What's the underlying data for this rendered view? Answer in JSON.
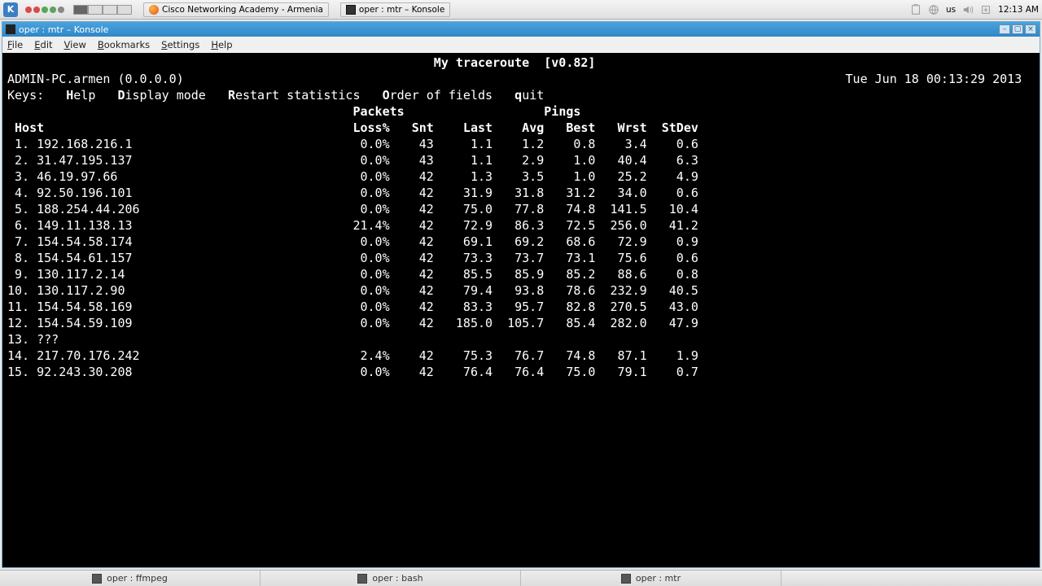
{
  "panel": {
    "task1": "Cisco Networking Academy - Armenia",
    "task2": "oper : mtr – Konsole",
    "lang": "us",
    "clock": "12:13 AM"
  },
  "window": {
    "title": "oper : mtr – Konsole",
    "menu": {
      "file": "File",
      "edit": "Edit",
      "view": "View",
      "bookmarks": "Bookmarks",
      "settings": "Settings",
      "help": "Help"
    }
  },
  "mtr": {
    "title": "My traceroute  [v0.82]",
    "hostline_left": "ADMIN-PC.armen (0.0.0.0)",
    "hostline_right": "Tue Jun 18 00:13:29 2013",
    "keys_prefix": "Keys:",
    "keys": [
      "Help",
      "Display mode",
      "Restart statistics",
      "Order of fields",
      "quit"
    ],
    "group_packets": "Packets",
    "group_pings": "Pings",
    "cols": {
      "host": "Host",
      "loss": "Loss%",
      "snt": "Snt",
      "last": "Last",
      "avg": "Avg",
      "best": "Best",
      "wrst": "Wrst",
      "stdev": "StDev"
    },
    "rows": [
      {
        "n": "1.",
        "host": "192.168.216.1",
        "loss": "0.0%",
        "snt": "43",
        "last": "1.1",
        "avg": "1.2",
        "best": "0.8",
        "wrst": "3.4",
        "stdev": "0.6"
      },
      {
        "n": "2.",
        "host": "31.47.195.137",
        "loss": "0.0%",
        "snt": "43",
        "last": "1.1",
        "avg": "2.9",
        "best": "1.0",
        "wrst": "40.4",
        "stdev": "6.3"
      },
      {
        "n": "3.",
        "host": "46.19.97.66",
        "loss": "0.0%",
        "snt": "42",
        "last": "1.3",
        "avg": "3.5",
        "best": "1.0",
        "wrst": "25.2",
        "stdev": "4.9"
      },
      {
        "n": "4.",
        "host": "92.50.196.101",
        "loss": "0.0%",
        "snt": "42",
        "last": "31.9",
        "avg": "31.8",
        "best": "31.2",
        "wrst": "34.0",
        "stdev": "0.6"
      },
      {
        "n": "5.",
        "host": "188.254.44.206",
        "loss": "0.0%",
        "snt": "42",
        "last": "75.0",
        "avg": "77.8",
        "best": "74.8",
        "wrst": "141.5",
        "stdev": "10.4"
      },
      {
        "n": "6.",
        "host": "149.11.138.13",
        "loss": "21.4%",
        "snt": "42",
        "last": "72.9",
        "avg": "86.3",
        "best": "72.5",
        "wrst": "256.0",
        "stdev": "41.2"
      },
      {
        "n": "7.",
        "host": "154.54.58.174",
        "loss": "0.0%",
        "snt": "42",
        "last": "69.1",
        "avg": "69.2",
        "best": "68.6",
        "wrst": "72.9",
        "stdev": "0.9"
      },
      {
        "n": "8.",
        "host": "154.54.61.157",
        "loss": "0.0%",
        "snt": "42",
        "last": "73.3",
        "avg": "73.7",
        "best": "73.1",
        "wrst": "75.6",
        "stdev": "0.6"
      },
      {
        "n": "9.",
        "host": "130.117.2.14",
        "loss": "0.0%",
        "snt": "42",
        "last": "85.5",
        "avg": "85.9",
        "best": "85.2",
        "wrst": "88.6",
        "stdev": "0.8"
      },
      {
        "n": "10.",
        "host": "130.117.2.90",
        "loss": "0.0%",
        "snt": "42",
        "last": "79.4",
        "avg": "93.8",
        "best": "78.6",
        "wrst": "232.9",
        "stdev": "40.5"
      },
      {
        "n": "11.",
        "host": "154.54.58.169",
        "loss": "0.0%",
        "snt": "42",
        "last": "83.3",
        "avg": "95.7",
        "best": "82.8",
        "wrst": "270.5",
        "stdev": "43.0"
      },
      {
        "n": "12.",
        "host": "154.54.59.109",
        "loss": "0.0%",
        "snt": "42",
        "last": "185.0",
        "avg": "105.7",
        "best": "85.4",
        "wrst": "282.0",
        "stdev": "47.9"
      },
      {
        "n": "13.",
        "host": "???",
        "loss": "",
        "snt": "",
        "last": "",
        "avg": "",
        "best": "",
        "wrst": "",
        "stdev": ""
      },
      {
        "n": "14.",
        "host": "217.70.176.242",
        "loss": "2.4%",
        "snt": "42",
        "last": "75.3",
        "avg": "76.7",
        "best": "74.8",
        "wrst": "87.1",
        "stdev": "1.9"
      },
      {
        "n": "15.",
        "host": "92.243.30.208",
        "loss": "0.0%",
        "snt": "42",
        "last": "76.4",
        "avg": "76.4",
        "best": "75.0",
        "wrst": "79.1",
        "stdev": "0.7"
      }
    ]
  },
  "tabs": [
    "oper : ffmpeg",
    "oper : bash",
    "oper : mtr"
  ]
}
